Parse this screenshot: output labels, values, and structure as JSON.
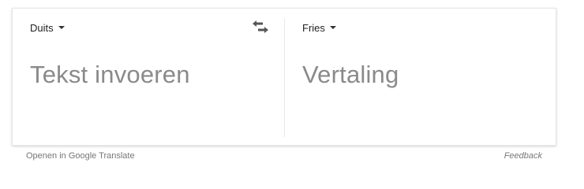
{
  "source": {
    "language": "Duits",
    "placeholder": "Tekst invoeren"
  },
  "target": {
    "language": "Fries",
    "placeholder": "Vertaling"
  },
  "swap_icon": "swap-horizontal-icon",
  "footer": {
    "open_link": "Openen in Google Translate",
    "feedback_link": "Feedback"
  }
}
